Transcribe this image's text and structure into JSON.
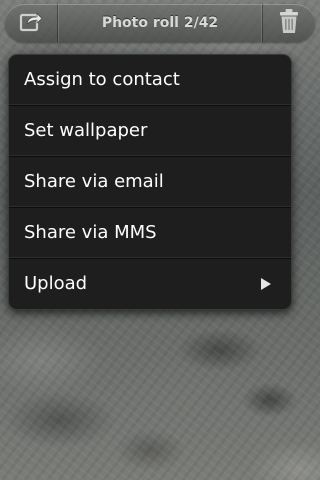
{
  "header": {
    "title": "Photo roll 2/42",
    "left_icon": "share-icon",
    "right_icon": "trash-icon"
  },
  "menu": {
    "items": [
      {
        "label": "Assign to contact",
        "has_submenu": false
      },
      {
        "label": "Set wallpaper",
        "has_submenu": false
      },
      {
        "label": "Share via email",
        "has_submenu": false
      },
      {
        "label": "Share via MMS",
        "has_submenu": false
      },
      {
        "label": "Upload",
        "has_submenu": true
      }
    ]
  },
  "colors": {
    "menu_background": "#1e1e1e",
    "menu_text": "#ffffff",
    "title_text": "#d8d8d8"
  }
}
